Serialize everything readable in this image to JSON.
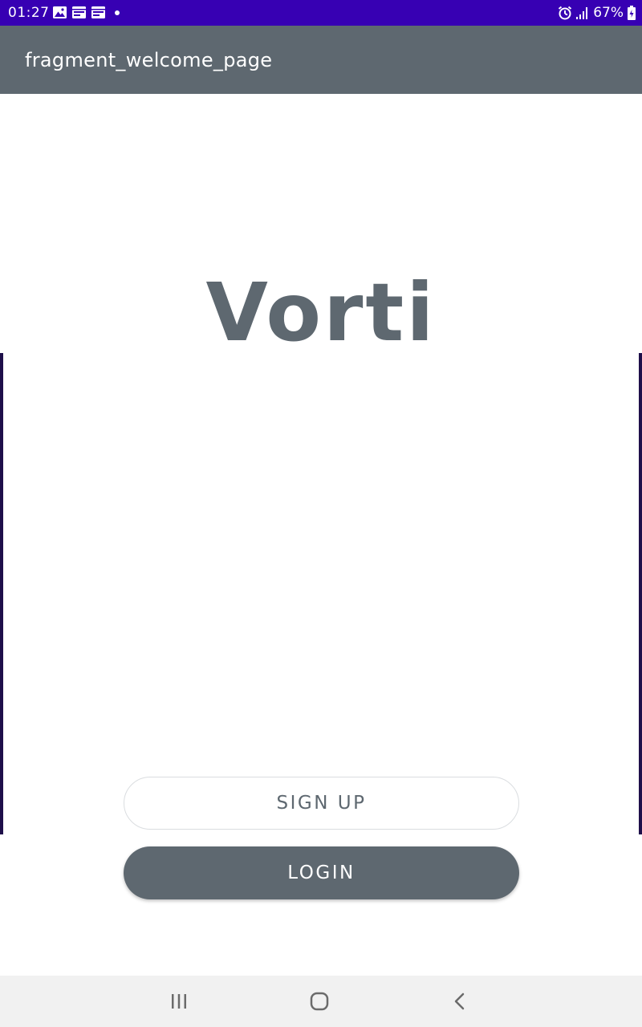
{
  "status_bar": {
    "time": "01:27",
    "battery_percent": "67%",
    "icons": [
      "gallery-icon",
      "calendar-icon",
      "calendar-icon",
      "notification-dot-icon",
      "alarm-icon",
      "signal-icon",
      "battery-icon"
    ]
  },
  "app_bar": {
    "title": "fragment_welcome_page"
  },
  "main": {
    "brand": "Vorti",
    "signup_label": "SIGN UP",
    "login_label": "LOGIN"
  },
  "nav_bar": {
    "icons": [
      "recents-icon",
      "home-icon",
      "back-icon"
    ]
  },
  "colors": {
    "status_bar": "#3700B3",
    "primary": "#5E6870",
    "background": "#FFFFFF",
    "nav_bar": "#F1F1F1"
  }
}
